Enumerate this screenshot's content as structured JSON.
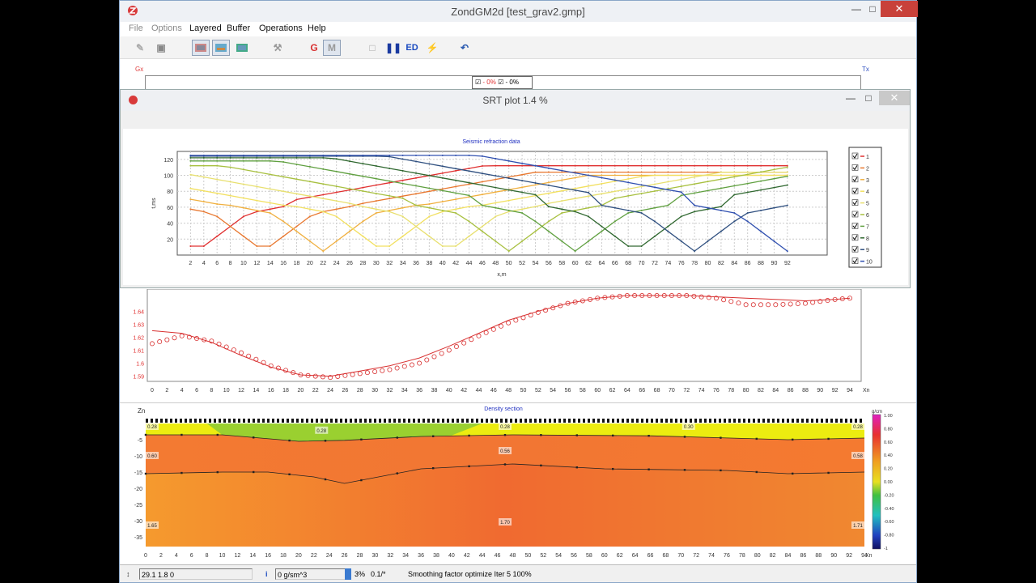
{
  "app": {
    "title": "ZondGM2d [test_grav2.gmp]"
  },
  "menu": {
    "items": [
      "File",
      "Options",
      "Layered",
      "Buffer",
      "Operations",
      "Help"
    ]
  },
  "toolbar": {
    "g_label": "G",
    "m_label": "M",
    "ed_label": "ED"
  },
  "top_area": {
    "gx_label": "Gx",
    "tx_label": "Tx",
    "legend_a": "- 0%",
    "legend_b": "- 0%"
  },
  "srt_window": {
    "title": "SRT plot 1.4 %"
  },
  "chart_data": [
    {
      "type": "line",
      "title": "Seismic refraction data",
      "xlabel": "x,m",
      "ylabel": "t,ms",
      "ylim": [
        0,
        130
      ],
      "xlim": [
        0,
        98
      ],
      "x_ticks": [
        2,
        4,
        6,
        8,
        10,
        12,
        14,
        16,
        18,
        20,
        22,
        24,
        26,
        28,
        30,
        32,
        34,
        36,
        38,
        40,
        42,
        44,
        46,
        48,
        50,
        52,
        54,
        56,
        58,
        60,
        62,
        64,
        66,
        68,
        70,
        72,
        74,
        76,
        78,
        80,
        82,
        84,
        86,
        88,
        90,
        92
      ],
      "y_ticks": [
        20,
        40,
        60,
        80,
        100,
        120
      ],
      "grid": true,
      "legend_position": "right",
      "series": [
        {
          "name": "1",
          "color": "#e03030",
          "source_x": 3,
          "peak": 112
        },
        {
          "name": "2",
          "color": "#e87830",
          "source_x": 13,
          "peak": 104
        },
        {
          "name": "3",
          "color": "#f0b040",
          "source_x": 22,
          "peak": 100
        },
        {
          "name": "4",
          "color": "#f2e060",
          "source_x": 31,
          "peak": 100
        },
        {
          "name": "5",
          "color": "#e8e070",
          "source_x": 41,
          "peak": 104
        },
        {
          "name": "6",
          "color": "#a8c040",
          "source_x": 50,
          "peak": 112
        },
        {
          "name": "7",
          "color": "#60a040",
          "source_x": 60,
          "peak": 118
        },
        {
          "name": "8",
          "color": "#306830",
          "source_x": 69,
          "peak": 122
        },
        {
          "name": "9",
          "color": "#305080",
          "source_x": 78,
          "peak": 124
        },
        {
          "name": "10",
          "color": "#3050b0",
          "source_x": 92,
          "peak": 125
        }
      ]
    },
    {
      "type": "line",
      "xlabel": "Xn",
      "y_ticks": [
        1.59,
        1.6,
        1.61,
        1.62,
        1.63,
        1.64
      ],
      "x_ticks": [
        0,
        2,
        4,
        6,
        8,
        10,
        12,
        14,
        16,
        18,
        20,
        22,
        24,
        26,
        28,
        30,
        32,
        34,
        36,
        38,
        40,
        42,
        44,
        46,
        48,
        50,
        52,
        54,
        56,
        58,
        60,
        62,
        64,
        66,
        68,
        70,
        72,
        74,
        76,
        78,
        80,
        82,
        84,
        86,
        88,
        90,
        92,
        94
      ],
      "observed": [
        [
          0,
          1.615
        ],
        [
          4,
          1.621
        ],
        [
          8,
          1.617
        ],
        [
          12,
          1.608
        ],
        [
          16,
          1.598
        ],
        [
          20,
          1.591
        ],
        [
          24,
          1.589
        ],
        [
          28,
          1.592
        ],
        [
          32,
          1.595
        ],
        [
          36,
          1.6
        ],
        [
          40,
          1.61
        ],
        [
          44,
          1.621
        ],
        [
          48,
          1.631
        ],
        [
          52,
          1.639
        ],
        [
          56,
          1.646
        ],
        [
          60,
          1.65
        ],
        [
          64,
          1.652
        ],
        [
          68,
          1.652
        ],
        [
          72,
          1.652
        ],
        [
          76,
          1.65
        ],
        [
          80,
          1.645
        ],
        [
          84,
          1.645
        ],
        [
          88,
          1.646
        ],
        [
          92,
          1.649
        ],
        [
          94,
          1.65
        ]
      ],
      "calculated": [
        [
          0,
          1.625
        ],
        [
          4,
          1.623
        ],
        [
          8,
          1.616
        ],
        [
          12,
          1.606
        ],
        [
          16,
          1.597
        ],
        [
          20,
          1.591
        ],
        [
          24,
          1.59
        ],
        [
          28,
          1.594
        ],
        [
          32,
          1.598
        ],
        [
          36,
          1.604
        ],
        [
          40,
          1.613
        ],
        [
          44,
          1.623
        ],
        [
          48,
          1.633
        ],
        [
          52,
          1.64
        ],
        [
          56,
          1.646
        ],
        [
          60,
          1.65
        ],
        [
          64,
          1.652
        ],
        [
          68,
          1.652
        ],
        [
          72,
          1.652
        ],
        [
          76,
          1.651
        ],
        [
          80,
          1.65
        ],
        [
          84,
          1.649
        ],
        [
          88,
          1.648
        ],
        [
          92,
          1.649
        ],
        [
          94,
          1.65
        ]
      ]
    },
    {
      "type": "heatmap",
      "title": "Density section",
      "xlabel": "Xn",
      "ylabel": "Zn",
      "y_ticks": [
        -5,
        -10,
        -15,
        -20,
        -25,
        -30,
        -35
      ],
      "x_ticks": [
        0,
        2,
        4,
        6,
        8,
        10,
        12,
        14,
        16,
        18,
        20,
        22,
        24,
        26,
        28,
        30,
        32,
        34,
        36,
        38,
        40,
        42,
        44,
        46,
        48,
        50,
        52,
        54,
        56,
        58,
        60,
        62,
        64,
        66,
        68,
        70,
        72,
        74,
        76,
        78,
        80,
        82,
        84,
        86,
        88,
        90,
        92,
        94
      ],
      "colorbar_ticks": [
        "1.00",
        "0.80",
        "0.60",
        "0.40",
        "0.20",
        "0.00",
        "-0.20",
        "-0.40",
        "-0.60",
        "-0.80",
        "-1"
      ],
      "colorbar_label": "g/cm",
      "layer_labels": [
        "0.28",
        "0.28",
        "0.28",
        "0.30",
        "0.28",
        "0.60",
        "0.56",
        "0.58",
        "1.65",
        "1.70",
        "1.71"
      ],
      "boundary1": [
        [
          0,
          -3.5
        ],
        [
          10,
          -3.5
        ],
        [
          20,
          -5.5
        ],
        [
          26,
          -5.2
        ],
        [
          36,
          -4.0
        ],
        [
          48,
          -3.5
        ],
        [
          66,
          -3.8
        ],
        [
          84,
          -5.0
        ],
        [
          94,
          -4.5
        ]
      ],
      "boundary2": [
        [
          0,
          -15.5
        ],
        [
          10,
          -15
        ],
        [
          16,
          -15
        ],
        [
          22,
          -16.5
        ],
        [
          26,
          -18.5
        ],
        [
          36,
          -14
        ],
        [
          48,
          -12.5
        ],
        [
          60,
          -14
        ],
        [
          76,
          -14.5
        ],
        [
          84,
          -15.5
        ],
        [
          94,
          -15
        ]
      ]
    }
  ],
  "status": {
    "coords": "29.1 1.8 0",
    "density": "0 g/sm^3",
    "pct": "3%",
    "ratio": "0.1/*",
    "message": "Smoothing factor optimize Iter 5 100%"
  }
}
